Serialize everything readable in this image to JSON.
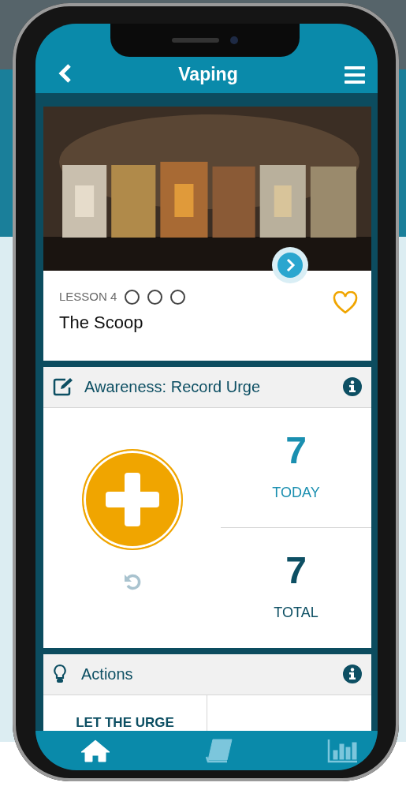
{
  "header": {
    "title": "Vaping"
  },
  "lesson": {
    "label": "LESSON 4",
    "progress": [
      {
        "done": false
      },
      {
        "done": false
      },
      {
        "done": false
      }
    ],
    "title": "The Scoop",
    "favorite": false
  },
  "awareness": {
    "title": "Awareness: Record Urge",
    "stats": [
      {
        "value": "7",
        "label": "TODAY",
        "kind": "today"
      },
      {
        "value": "7",
        "label": "TOTAL",
        "kind": "total"
      }
    ]
  },
  "actions": {
    "title": "Actions",
    "items": [
      "LET THE URGE"
    ]
  },
  "bottom_nav": [
    {
      "kind": "home",
      "selected": true
    },
    {
      "kind": "book",
      "selected": false
    },
    {
      "kind": "chart",
      "selected": false
    }
  ]
}
